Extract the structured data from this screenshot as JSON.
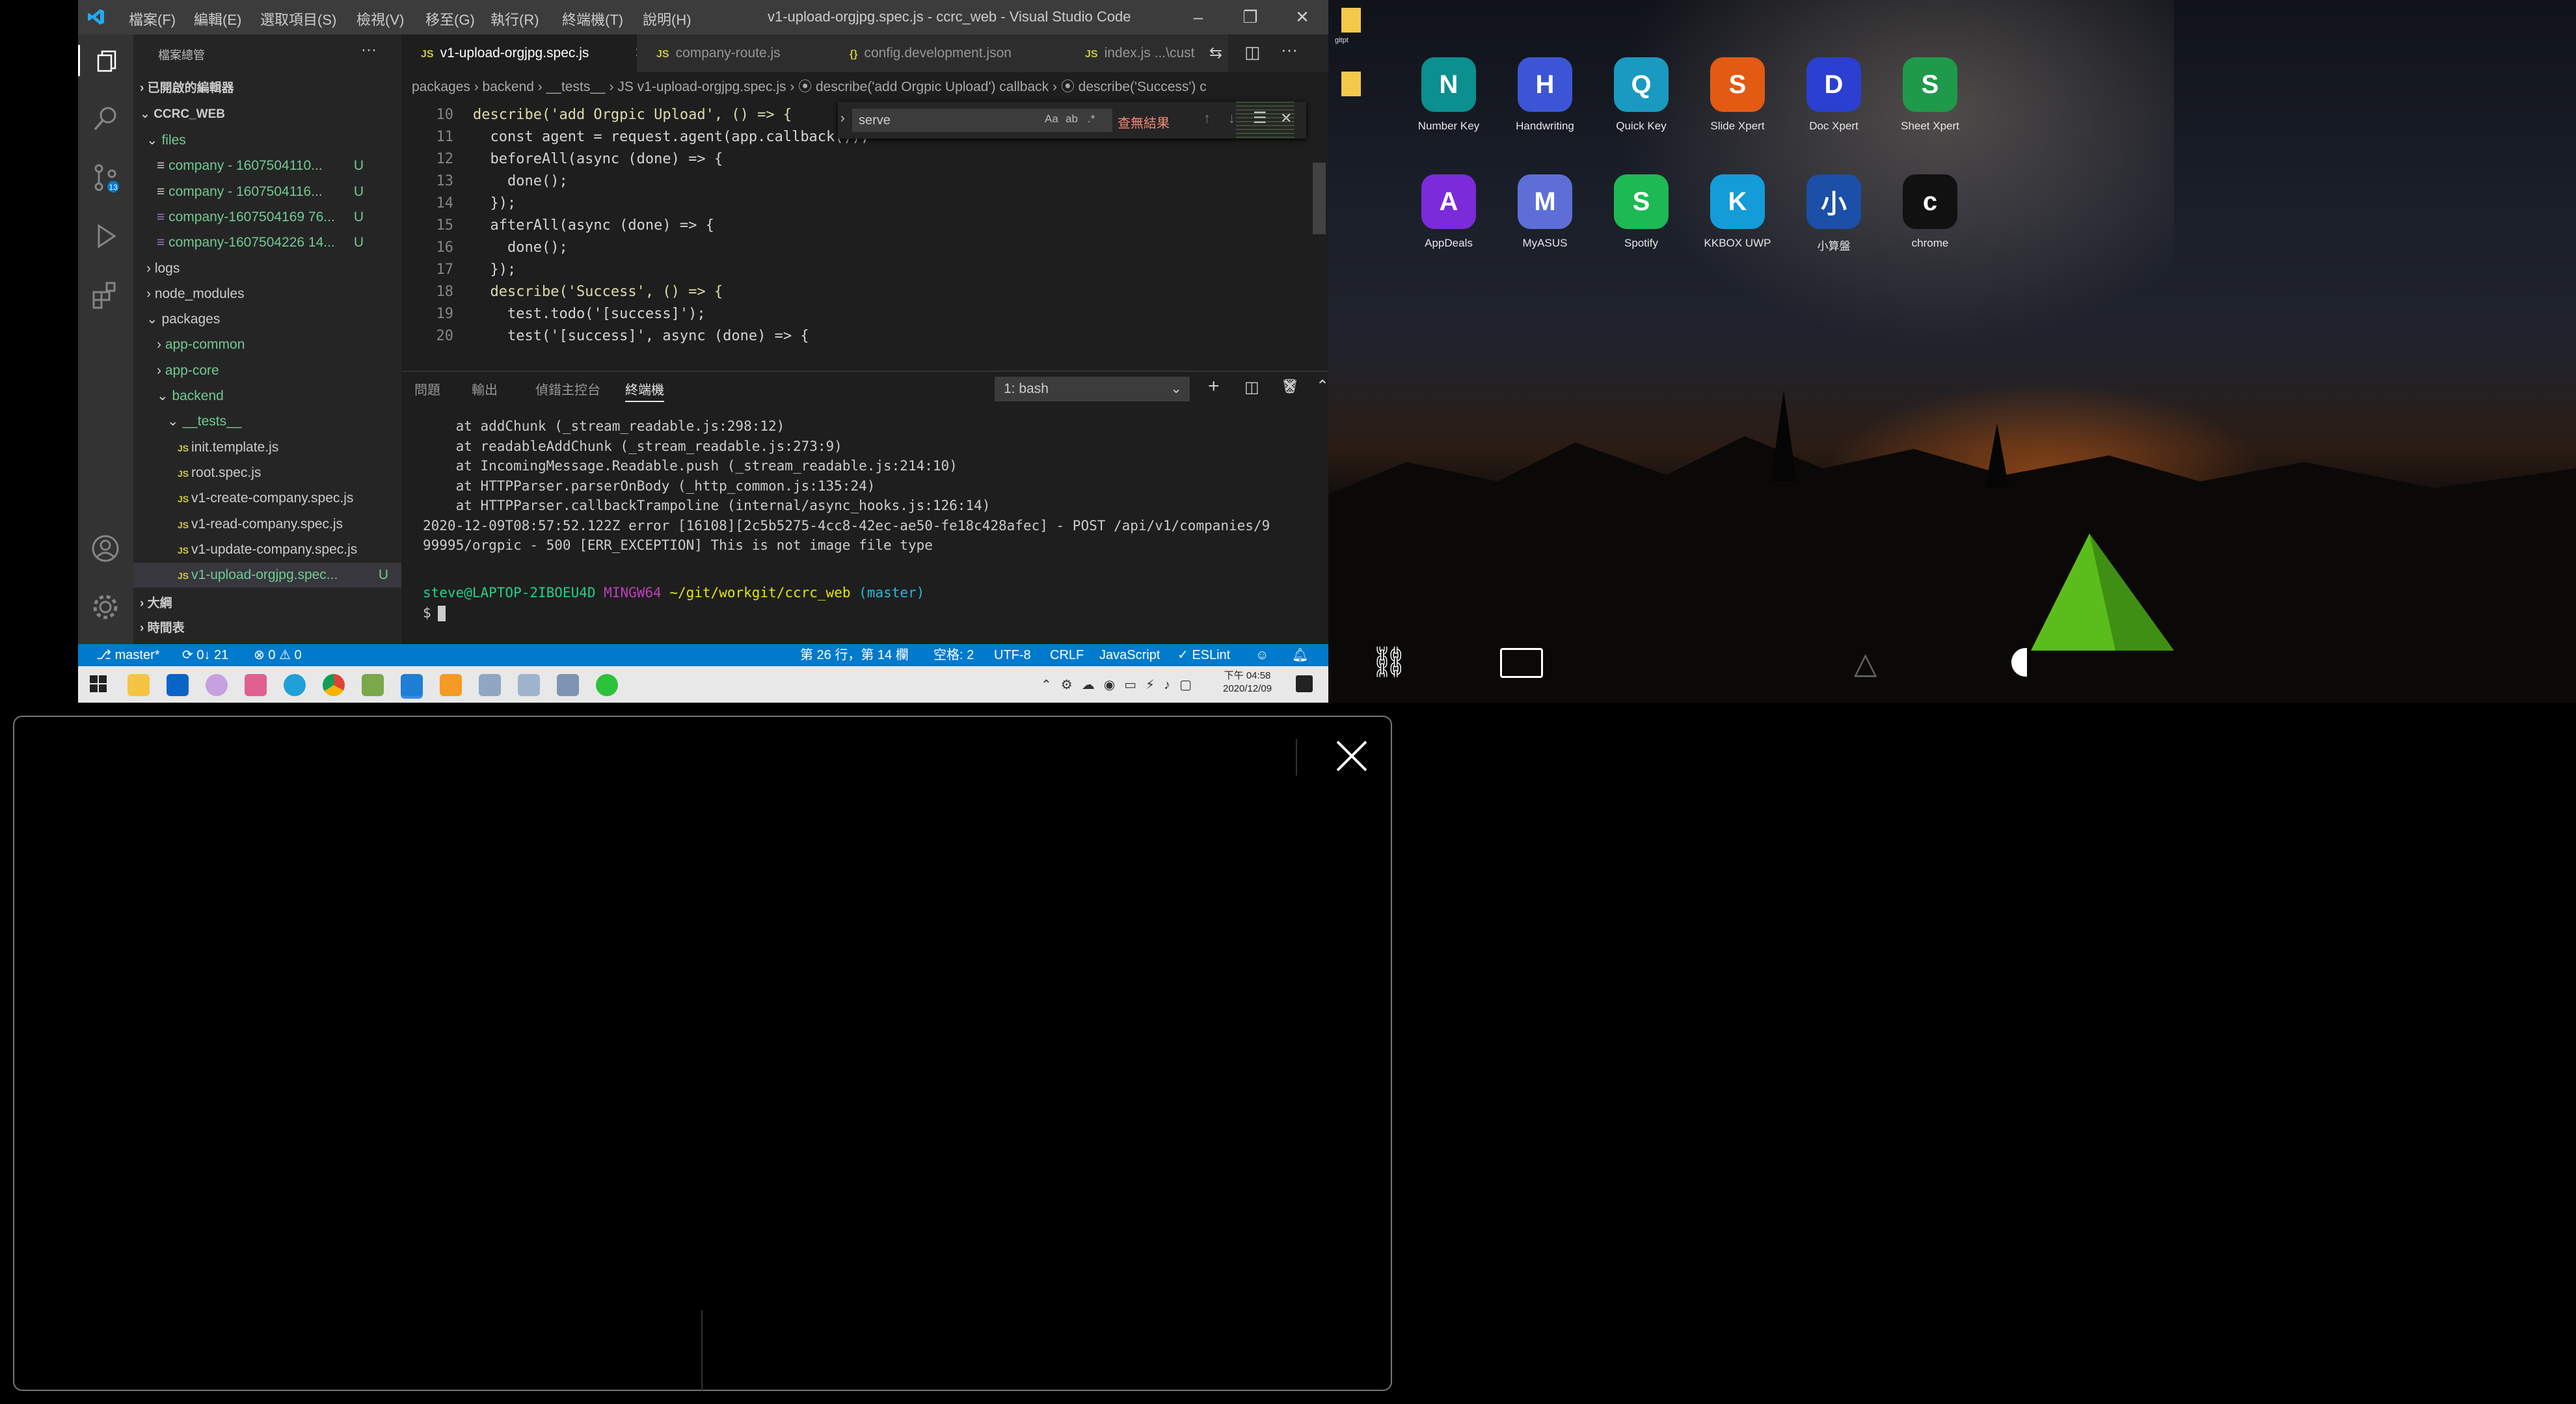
{
  "vscode": {
    "window_title": "v1-upload-orgjpg.spec.js - ccrc_web - Visual Studio Code",
    "menu": [
      "檔案(F)",
      "編輯(E)",
      "選取項目(S)",
      "檢視(V)",
      "移至(G)",
      "執行(R)",
      "終端機(T)",
      "說明(H)"
    ],
    "sidebar": {
      "header": "檔案總管",
      "open_editors": "已開啟的編輯器",
      "project": "CCRC_WEB",
      "rows": [
        {
          "label": "files",
          "badge": ""
        },
        {
          "label": "company  -  1607504110...",
          "badge": "U"
        },
        {
          "label": "company  -  1607504116...",
          "badge": "U"
        },
        {
          "label": "company-1607504169 76...",
          "badge": "U"
        },
        {
          "label": "company-1607504226 14...",
          "badge": "U"
        },
        {
          "label": "logs",
          "badge": ""
        },
        {
          "label": "node_modules",
          "badge": ""
        },
        {
          "label": "packages",
          "badge": ""
        },
        {
          "label": "app-common",
          "badge": ""
        },
        {
          "label": "app-core",
          "badge": ""
        },
        {
          "label": "backend",
          "badge": ""
        },
        {
          "label": "__tests__",
          "badge": ""
        },
        {
          "label": "init.template.js",
          "badge": ""
        },
        {
          "label": "root.spec.js",
          "badge": ""
        },
        {
          "label": "v1-create-company.spec.js",
          "badge": ""
        },
        {
          "label": "v1-read-company.spec.js",
          "badge": ""
        },
        {
          "label": "v1-update-company.spec.js",
          "badge": ""
        },
        {
          "label": "v1-upload-orgjpg.spec...",
          "badge": "U"
        }
      ],
      "outline": "大綱",
      "timeline": "時間表"
    },
    "tabs": [
      {
        "label": "v1-upload-orgjpg.spec.js",
        "type": "JS"
      },
      {
        "label": "company-route.js",
        "type": "JS"
      },
      {
        "label": "config.development.json",
        "type": "{}"
      },
      {
        "label": "index.js ...\\cust",
        "type": "JS"
      }
    ],
    "breadcrumb": "packages  ›  backend  ›  __tests__  ›  JS  v1-upload-orgjpg.spec.js  ›  ⦿ describe('add Orgpic Upload') callback  ›  ⦿ describe('Success') c",
    "code_lines": [
      {
        "n": "10",
        "text": "describe('add Orgpic Upload', () => {"
      },
      {
        "n": "11",
        "text": "  const agent = request.agent(app.callback());"
      },
      {
        "n": "12",
        "text": "  beforeAll(async (done) => {"
      },
      {
        "n": "13",
        "text": "    done();"
      },
      {
        "n": "14",
        "text": "  });"
      },
      {
        "n": "15",
        "text": "  afterAll(async (done) => {"
      },
      {
        "n": "16",
        "text": "    done();"
      },
      {
        "n": "17",
        "text": "  });"
      },
      {
        "n": "18",
        "text": "  describe('Success', () => {"
      },
      {
        "n": "19",
        "text": "    test.todo('[success]');"
      },
      {
        "n": "20",
        "text": "    test('[success]', async (done) => {"
      }
    ],
    "find": {
      "value": "serve",
      "result": "查無結果"
    },
    "panel_tabs": [
      "問題",
      "輸出",
      "偵錯主控台",
      "終端機"
    ],
    "terminal_select": "1: bash",
    "terminal_lines": [
      "    at addChunk (_stream_readable.js:298:12)",
      "    at readableAddChunk (_stream_readable.js:273:9)",
      "    at IncomingMessage.Readable.push (_stream_readable.js:214:10)",
      "    at HTTPParser.parserOnBody (_http_common.js:135:24)",
      "    at HTTPParser.callbackTrampoline (internal/async_hooks.js:126:14)",
      "2020-12-09T08:57:52.122Z error [16108][2c5b5275-4cc8-42ec-ae50-fe18c428afec] - POST /api/v1/companies/9",
      "99995/orgpic - 500 [ERR_EXCEPTION] This is not image file type"
    ],
    "prompt": {
      "user": "steve@LAPTOP-2IBOEU4D",
      "shell": "MINGW64",
      "path": "~/git/workgit/ccrc_web",
      "branch": "(master)",
      "symbol": "$"
    },
    "status": {
      "branch": "master*",
      "sync": "0↓ 21",
      "problems": "⊗ 0 ⚠ 0",
      "position": "第 26 行，第 14 欄",
      "spaces": "空格: 2",
      "encoding": "UTF-8",
      "eol": "CRLF",
      "language": "JavaScript",
      "eslint": "✓ ESLint"
    },
    "clock": {
      "time": "下午 04:58",
      "date": "2020/12/09"
    }
  },
  "desktop": {
    "apps_row1": [
      {
        "name": "Number Key",
        "icon": "number-key-icon",
        "color": "#0b8f8f"
      },
      {
        "name": "Handwriting",
        "icon": "handwriting-icon",
        "color": "#3b55d6"
      },
      {
        "name": "Quick Key",
        "icon": "quick-key-icon",
        "color": "#1a9ac0"
      },
      {
        "name": "Slide Xpert",
        "icon": "slide-xpert-icon",
        "color": "#e35a12"
      },
      {
        "name": "Doc Xpert",
        "icon": "doc-xpert-icon",
        "color": "#2b3fd0"
      },
      {
        "name": "Sheet Xpert",
        "icon": "sheet-xpert-icon",
        "color": "#1f9a4a"
      }
    ],
    "apps_row2": [
      {
        "name": "AppDeals",
        "icon": "appdeals-icon",
        "color": "#7b2bd9"
      },
      {
        "name": "MyASUS",
        "icon": "myasus-icon",
        "color": "#5d6fd6"
      },
      {
        "name": "Spotify",
        "icon": "spotify-icon",
        "color": "#1db954"
      },
      {
        "name": "KKBOX UWP",
        "icon": "kkbox-icon",
        "color": "#139cd8"
      },
      {
        "name": "小算盤",
        "icon": "calculator-icon",
        "color": "#1b4fa8"
      },
      {
        "name": "chrome",
        "icon": "chrome-icon",
        "color": "#111111"
      }
    ],
    "file_icon_label": "gitpt"
  }
}
